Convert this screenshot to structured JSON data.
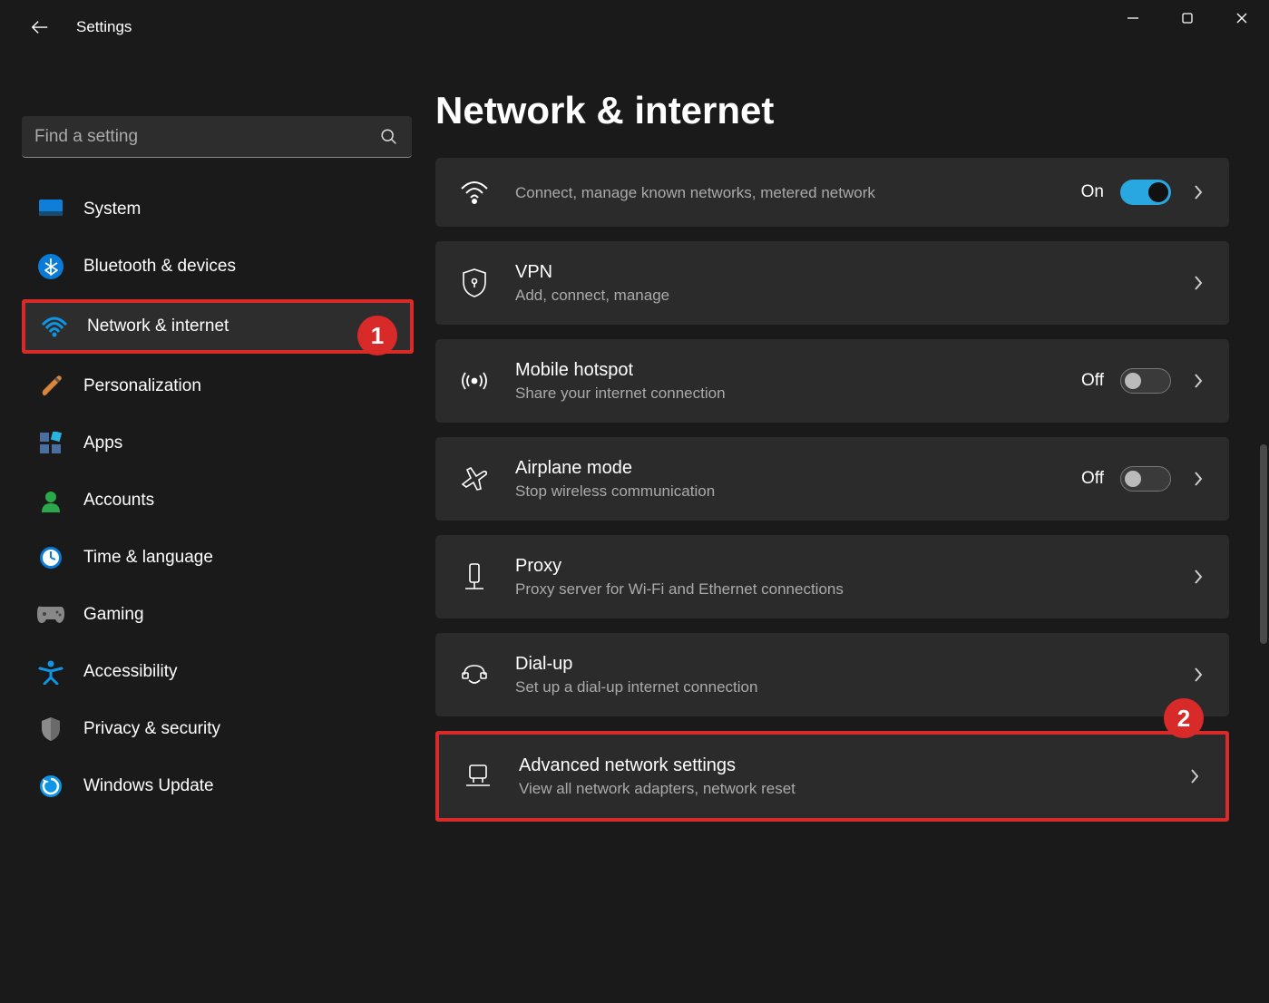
{
  "app": {
    "title": "Settings"
  },
  "search": {
    "placeholder": "Find a setting"
  },
  "sidebar": {
    "items": [
      {
        "label": "System"
      },
      {
        "label": "Bluetooth & devices"
      },
      {
        "label": "Network & internet"
      },
      {
        "label": "Personalization"
      },
      {
        "label": "Apps"
      },
      {
        "label": "Accounts"
      },
      {
        "label": "Time & language"
      },
      {
        "label": "Gaming"
      },
      {
        "label": "Accessibility"
      },
      {
        "label": "Privacy & security"
      },
      {
        "label": "Windows Update"
      }
    ]
  },
  "page": {
    "title": "Network & internet"
  },
  "settings": {
    "wifi": {
      "desc": "Connect, manage known networks, metered network",
      "state": "On"
    },
    "vpn": {
      "title": "VPN",
      "desc": "Add, connect, manage"
    },
    "hotspot": {
      "title": "Mobile hotspot",
      "desc": "Share your internet connection",
      "state": "Off"
    },
    "airplane": {
      "title": "Airplane mode",
      "desc": "Stop wireless communication",
      "state": "Off"
    },
    "proxy": {
      "title": "Proxy",
      "desc": "Proxy server for Wi-Fi and Ethernet connections"
    },
    "dialup": {
      "title": "Dial-up",
      "desc": "Set up a dial-up internet connection"
    },
    "advanced": {
      "title": "Advanced network settings",
      "desc": "View all network adapters, network reset"
    }
  },
  "annotations": {
    "b1": "1",
    "b2": "2"
  }
}
